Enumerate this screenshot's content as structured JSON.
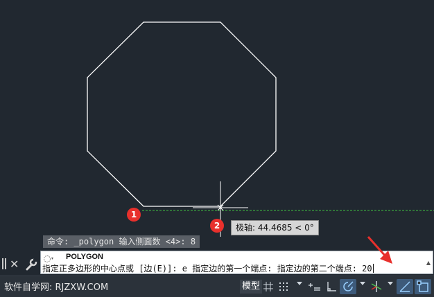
{
  "colors": {
    "canvas_background": "#212830",
    "geometry_stroke": "#ffffff",
    "tracking_line": "#3fbf3f",
    "marker_fill": "#e8302c",
    "active_button": "#3d5a7a"
  },
  "canvas": {
    "markers": [
      "1",
      "2"
    ],
    "tooltip": "极轴: 44.4685 < 0°",
    "history_line": "命令: _polygon 输入侧面数 <4>: 8"
  },
  "command_line": {
    "command_name": "POLYGON",
    "prompt": "指定正多边形的中心点或 [边(E)]: e 指定边的第一个端点: 指定边的第二个端点: ",
    "input_value": "20",
    "icons": [
      "grip-icon",
      "close-icon",
      "wrench-icon",
      "command-icon",
      "scroll-up-icon"
    ]
  },
  "status_bar": {
    "watermark": "软件自学网: RJZXW.COM",
    "model_tab": "模型",
    "icons": [
      "grid-icon",
      "dropdown-icon",
      "dynamic-input-icon",
      "ortho-icon",
      "polar-tracking-icon",
      "isodraft-icon",
      "object-snap-tracking-icon",
      "object-snap-icon"
    ]
  }
}
